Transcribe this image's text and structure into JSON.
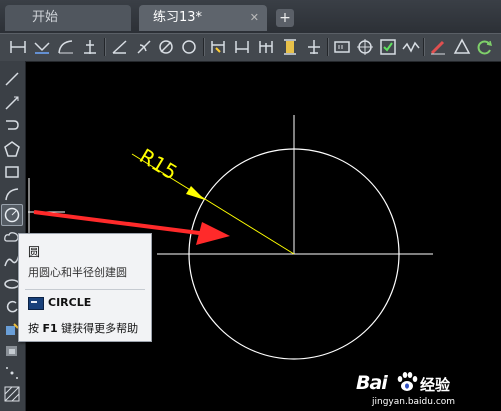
{
  "tabs": {
    "start_label": "开始",
    "active_label": "练习13*",
    "close_glyph": "✕",
    "new_tab_glyph": "+"
  },
  "toolbar_icons": [
    "line-icon",
    "ray-icon",
    "arc-icon",
    "coordinate-icon",
    "angle-icon",
    "tangent-arc-icon",
    "no-entry-icon",
    "circle-icon",
    "align-icon",
    "linear-dim-icon",
    "parallel-dim-icon",
    "text-height-icon",
    "baseline-icon",
    "block-icon",
    "target-icon",
    "checkmark-icon",
    "wave-icon",
    "pen-icon",
    "triangle-icon",
    "refresh-icon"
  ],
  "left_toolbar_icons": [
    "line-icon",
    "ray-icon",
    "polyline-icon",
    "polygon-icon",
    "rectangle-icon",
    "arc-icon",
    "circle-icon",
    "cloud-icon",
    "spline-icon",
    "ellipse-icon",
    "rotate-icon",
    "insert-icon",
    "block-icon",
    "point-icon",
    "hatch-icon"
  ],
  "drawing": {
    "radius_label": "R15",
    "line_color": "#ffffff",
    "dimension_color": "#ffff00",
    "arrow_color": "#ff2a2a"
  },
  "tooltip": {
    "title": "圆",
    "description": "用圆心和半径创建圆",
    "command": "CIRCLE",
    "help_prefix": "按",
    "help_key": "F1",
    "help_suffix": "键获得更多帮助"
  },
  "watermark": {
    "brand_left": "Bai",
    "brand_right": "经验",
    "url": "jingyan.baidu.com"
  }
}
